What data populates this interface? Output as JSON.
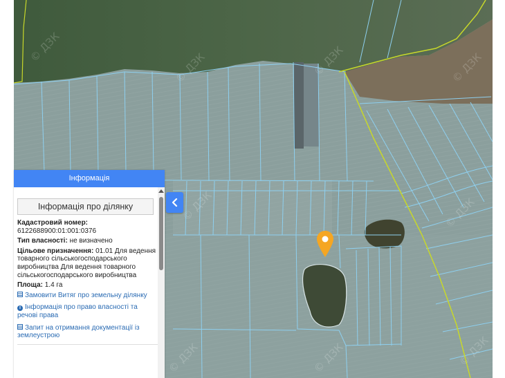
{
  "panel": {
    "header": "Інформація",
    "section_title": "Інформація про ділянку",
    "cadastral_label": "Кадастровий номер:",
    "cadastral_value": "6122688900:01:001:0376",
    "ownership_label": "Тип власності:",
    "ownership_value": "не визначено",
    "purpose_label": "Цільове призначення:",
    "purpose_value": "01.01 Для ведення товарного сільськогосподарського виробництва Для ведення товарного сільськогосподарського виробництва",
    "area_label": "Площа:",
    "area_value": "1.4 га",
    "links": [
      {
        "label": "Замовити Витяг про земельну ділянку",
        "icon": "document-icon"
      },
      {
        "label": "Інформація про право власності та речові права",
        "icon": "info-icon"
      },
      {
        "label": "Запит на отримання документації із землеустрою",
        "icon": "document-icon"
      }
    ]
  },
  "map": {
    "watermark": "© ДЗК",
    "marker_icon": "location-pin-icon",
    "collapse_icon": "chevron-left-icon"
  },
  "colors": {
    "accent": "#4285f4",
    "parcel_lines": "#8ed0f0",
    "boundary": "#c8d82a",
    "marker": "#f5a623"
  }
}
